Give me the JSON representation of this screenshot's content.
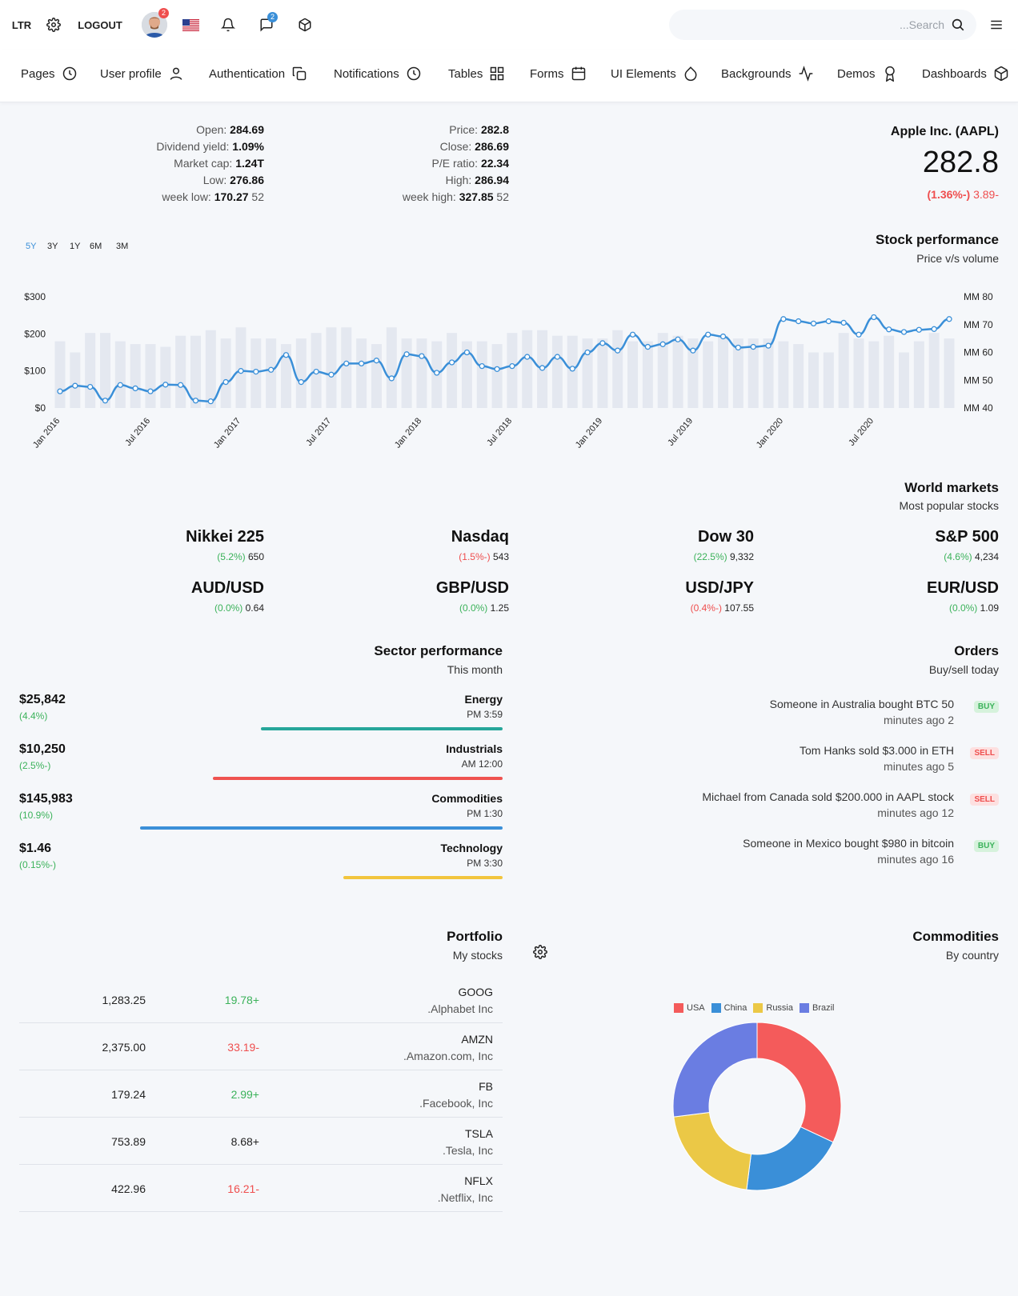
{
  "topbar": {
    "dir_label": "LTR",
    "logout_label": "LOGOUT",
    "avatar_badge": "2",
    "messages_badge": "2",
    "search_placeholder": "...Search"
  },
  "nav": {
    "items": [
      {
        "label": "Pages",
        "icon": "clock-icon"
      },
      {
        "label": "User profile",
        "icon": "user-icon"
      },
      {
        "label": "Authentication",
        "icon": "copy-icon"
      },
      {
        "label": "Notifications",
        "icon": "clock-icon"
      },
      {
        "label": "Tables",
        "icon": "grid-icon"
      },
      {
        "label": "Forms",
        "icon": "calendar-icon"
      },
      {
        "label": "UI Elements",
        "icon": "droplet-icon"
      },
      {
        "label": "Backgrounds",
        "icon": "activity-icon"
      },
      {
        "label": "Demos",
        "icon": "award-icon"
      },
      {
        "label": "Dashboards",
        "icon": "box-icon"
      }
    ]
  },
  "stock": {
    "name": "Apple Inc. (AAPL)",
    "price_big": "282.8",
    "change_pct": "(1.36%-)",
    "change_abs": "3.89-",
    "left_stats": [
      {
        "label": "Open:",
        "value": "284.69",
        "suffix": ""
      },
      {
        "label": "Dividend yield:",
        "value": "1.09%",
        "suffix": ""
      },
      {
        "label": "Market cap:",
        "value": "1.24T",
        "suffix": ""
      },
      {
        "label": "Low:",
        "value": "276.86",
        "suffix": ""
      },
      {
        "label": "week low:",
        "value": "170.27",
        "suffix": "52"
      }
    ],
    "right_stats": [
      {
        "label": "Price:",
        "value": "282.8",
        "suffix": ""
      },
      {
        "label": "Close:",
        "value": "286.69",
        "suffix": ""
      },
      {
        "label": "P/E ratio:",
        "value": "22.34",
        "suffix": ""
      },
      {
        "label": "High:",
        "value": "286.94",
        "suffix": ""
      },
      {
        "label": "week high:",
        "value": "327.85",
        "suffix": "52"
      }
    ]
  },
  "performance": {
    "title": "Stock performance",
    "subtitle": "Price v/s volume",
    "ranges": [
      "5Y",
      "3Y",
      "1Y",
      "6M",
      "3M"
    ],
    "active_range": "5Y"
  },
  "chart_data": {
    "type": "bar+line",
    "left_axis": {
      "ticks": [
        "$0",
        "$100",
        "$200",
        "$300"
      ],
      "range": [
        0,
        300
      ]
    },
    "right_axis": {
      "ticks": [
        "MM 40",
        "MM 50",
        "MM 60",
        "MM 70",
        "MM 80"
      ],
      "range": [
        40,
        80
      ]
    },
    "x_ticks": [
      "Jan 2016",
      "Jul 2016",
      "Jan 2017",
      "Jul 2017",
      "Jan 2018",
      "Jul 2018",
      "Jan 2019",
      "Jul 2019",
      "Jan 2020",
      "Jul 2020"
    ],
    "series": [
      {
        "type": "line",
        "axis": "left",
        "color": "#3a8fd8",
        "values": [
          45,
          60,
          57,
          20,
          62,
          53,
          45,
          63,
          62,
          20,
          18,
          70,
          100,
          98,
          103,
          143,
          70,
          98,
          90,
          120,
          120,
          128,
          80,
          145,
          140,
          95,
          123,
          150,
          113,
          105,
          113,
          138,
          108,
          138,
          106,
          150,
          175,
          155,
          198,
          165,
          172,
          185,
          155,
          198,
          193,
          163,
          165,
          168,
          240,
          234,
          228,
          234,
          230,
          198,
          245,
          212,
          205,
          211,
          213,
          240
        ]
      },
      {
        "type": "bar",
        "axis": "right",
        "color": "#e4e8f0",
        "values": [
          64,
          60,
          67,
          67,
          64,
          63,
          63,
          62,
          66,
          66,
          68,
          65,
          69,
          65,
          65,
          63,
          65,
          67,
          69,
          69,
          65,
          63,
          69,
          65,
          65,
          64,
          67,
          64,
          64,
          63,
          67,
          68,
          68,
          66,
          66,
          65,
          65,
          68,
          64,
          64,
          67,
          66,
          65,
          64,
          66,
          65,
          65,
          65,
          64,
          63,
          60,
          60,
          67,
          65,
          64,
          66,
          60,
          64,
          67,
          65
        ]
      }
    ]
  },
  "world_markets": {
    "title": "World markets",
    "subtitle": "Most popular stocks",
    "items": [
      {
        "name": "S&P 500",
        "pct": "(4.6%)",
        "dir": "gain",
        "value": "4,234"
      },
      {
        "name": "Dow 30",
        "pct": "(22.5%)",
        "dir": "gain",
        "value": "9,332"
      },
      {
        "name": "Nasdaq",
        "pct": "(1.5%-)",
        "dir": "loss",
        "value": "543"
      },
      {
        "name": "Nikkei 225",
        "pct": "(5.2%)",
        "dir": "gain",
        "value": "650"
      },
      {
        "name": "EUR/USD",
        "pct": "(0.0%)",
        "dir": "gain",
        "value": "1.09"
      },
      {
        "name": "USD/JPY",
        "pct": "(0.4%-)",
        "dir": "loss",
        "value": "107.55"
      },
      {
        "name": "GBP/USD",
        "pct": "(0.0%)",
        "dir": "gain",
        "value": "1.25"
      },
      {
        "name": "AUD/USD",
        "pct": "(0.0%)",
        "dir": "gain",
        "value": "0.64"
      }
    ]
  },
  "sectors": {
    "title": "Sector performance",
    "subtitle": "This month",
    "items": [
      {
        "value": "$25,842",
        "pct": "(4.4%)",
        "label": "Energy",
        "time": "PM 3:59",
        "color": "#26a69a",
        "fill": 0.5
      },
      {
        "value": "$10,250",
        "pct": "(2.5%-)",
        "label": "Industrials",
        "time": "AM 12:00",
        "color": "#ef5350",
        "fill": 0.6
      },
      {
        "value": "$145,983",
        "pct": "(10.9%)",
        "label": "Commodities",
        "time": "PM 1:30",
        "color": "#3a8fd8",
        "fill": 0.75
      },
      {
        "value": "$1.46",
        "pct": "(0.15%-)",
        "label": "Technology",
        "time": "PM 3:30",
        "color": "#f2c53d",
        "fill": 0.33
      }
    ]
  },
  "orders": {
    "title": "Orders",
    "subtitle": "Buy/sell today",
    "items": [
      {
        "text": "Someone in Australia bought BTC 50",
        "ago": "minutes ago 2",
        "tag": "BUY",
        "kind": "buy"
      },
      {
        "text": "Tom Hanks sold $3.000 in ETH",
        "ago": "minutes ago 5",
        "tag": "SELL",
        "kind": "sell"
      },
      {
        "text": "Michael from Canada sold $200.000 in AAPL stock",
        "ago": "minutes ago 12",
        "tag": "SELL",
        "kind": "sell"
      },
      {
        "text": "Someone in Mexico bought $980 in bitcoin",
        "ago": "minutes ago 16",
        "tag": "BUY",
        "kind": "buy"
      }
    ]
  },
  "portfolio": {
    "title": "Portfolio",
    "subtitle": "My stocks",
    "rows": [
      {
        "ticker": "GOOG",
        "company": ".Alphabet Inc",
        "price": "1,283.25",
        "change": "19.78+",
        "dir": "gain"
      },
      {
        "ticker": "AMZN",
        "company": ".Amazon.com, Inc",
        "price": "2,375.00",
        "change": "33.19-",
        "dir": "loss"
      },
      {
        "ticker": "FB",
        "company": ".Facebook, Inc",
        "price": "179.24",
        "change": "2.99+",
        "dir": "gain"
      },
      {
        "ticker": "TSLA",
        "company": ".Tesla, Inc",
        "price": "753.89",
        "change": "8.68+",
        "dir": "neutral"
      },
      {
        "ticker": "NFLX",
        "company": ".Netflix, Inc",
        "price": "422.96",
        "change": "16.21-",
        "dir": "loss"
      }
    ]
  },
  "commodities": {
    "title": "Commodities",
    "subtitle": "By country",
    "chart_data": {
      "type": "pie",
      "variant": "doughnut",
      "legend_position": "top",
      "categories": [
        "USA",
        "China",
        "Russia",
        "Brazil"
      ],
      "values": [
        32,
        20,
        21,
        27
      ],
      "colors": [
        "#f45b5b",
        "#3a8fd8",
        "#ebc846",
        "#6a7de2"
      ]
    }
  },
  "colors": {
    "gain": "#3bb25a",
    "loss": "#ef4e4e",
    "accent": "#3a8fd8"
  }
}
